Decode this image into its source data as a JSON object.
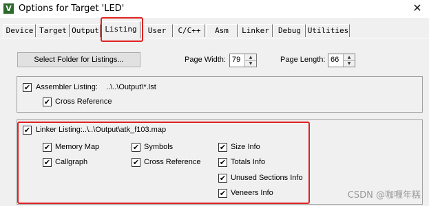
{
  "window": {
    "icon_glyph": "V",
    "title": "Options for Target 'LED'",
    "close_glyph": "✕"
  },
  "tabs": [
    "Device",
    "Target",
    "Output",
    "Listing",
    "User",
    "C/C++",
    "Asm",
    "Linker",
    "Debug",
    "Utilities"
  ],
  "active_tab": "Listing",
  "listing": {
    "select_folder_button": "Select Folder for Listings...",
    "page_width_label": "Page Width:",
    "page_width_value": "79",
    "page_length_label": "Page Length:",
    "page_length_value": "66",
    "assembler": {
      "checked": true,
      "label": "Assembler Listing:",
      "path": "..\\..\\Output\\*.lst",
      "cross_reference_label": "Cross Reference",
      "cross_reference_checked": true
    },
    "linker": {
      "checked": true,
      "label": "Linker Listing:",
      "path": "..\\..\\Output\\atk_f103.map",
      "options": {
        "memory_map": "Memory Map",
        "symbols": "Symbols",
        "size_info": "Size Info",
        "callgraph": "Callgraph",
        "cross_reference": "Cross Reference",
        "totals_info": "Totals Info",
        "unused_sections_info": "Unused Sections Info",
        "veneers_info": "Veneers Info"
      },
      "all_checked": true
    }
  },
  "check_glyph": "✔",
  "spin_up_glyph": "▲",
  "spin_down_glyph": "▼",
  "watermark": "CSDN @咖喱年糕",
  "highlight_color": "#e02020"
}
